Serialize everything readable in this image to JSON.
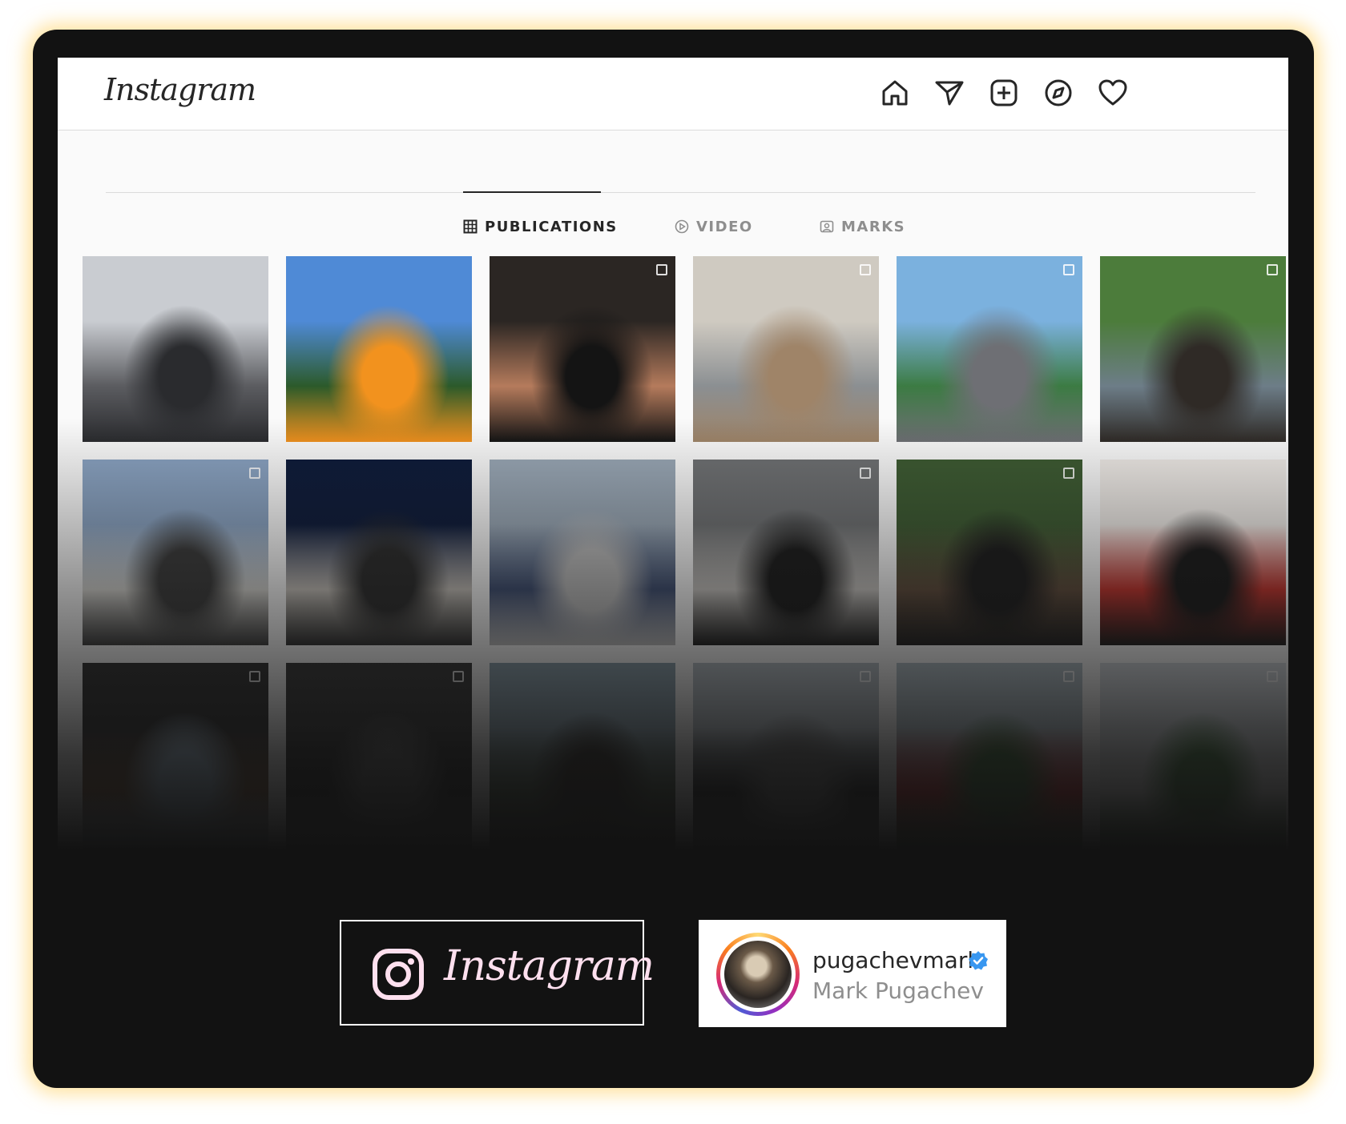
{
  "app": {
    "logo_text": "Instagram"
  },
  "nav": {
    "icons": [
      "home-icon",
      "direct-message-icon",
      "new-post-icon",
      "explore-icon",
      "activity-heart-icon"
    ]
  },
  "tabs": [
    {
      "label": "PUBLICATIONS",
      "icon": "grid-icon",
      "active": true
    },
    {
      "label": "VIDEO",
      "icon": "play-icon",
      "active": false
    },
    {
      "label": "MARKS",
      "icon": "tagged-icon",
      "active": false
    }
  ],
  "grid": {
    "rows": 3,
    "columns": 6,
    "tiles": [
      {
        "colors": [
          "#c9ccd1",
          "#5b5c60",
          "#2a2b2e"
        ],
        "multi": false
      },
      {
        "colors": [
          "#4f8ad6",
          "#2c5a2a",
          "#f2921e"
        ],
        "multi": false
      },
      {
        "colors": [
          "#2b2623",
          "#b57b5c",
          "#141414"
        ],
        "multi": true
      },
      {
        "colors": [
          "#cfcac1",
          "#8b8f92",
          "#9f8468"
        ],
        "multi": true
      },
      {
        "colors": [
          "#7bb1de",
          "#3c7b43",
          "#6e6f74"
        ],
        "multi": true
      },
      {
        "colors": [
          "#4c7c3b",
          "#6d7d88",
          "#2f2a26"
        ],
        "multi": true
      },
      {
        "colors": [
          "#8aa3c2",
          "#d7d6d1",
          "#3b3b3b"
        ],
        "multi": true
      },
      {
        "colors": [
          "#0e1b3a",
          "#c9c4bd",
          "#2c2c2c"
        ],
        "multi": false
      },
      {
        "colors": [
          "#9aa8b6",
          "#3e4e72",
          "#bcbcbc"
        ],
        "multi": false
      },
      {
        "colors": [
          "#6f7173",
          "#c9c6c2",
          "#1b1b1b"
        ],
        "multi": true
      },
      {
        "colors": [
          "#3d5b32",
          "#5f4b3b",
          "#1c1c1c"
        ],
        "multi": true
      },
      {
        "colors": [
          "#efebe7",
          "#c8332c",
          "#1a1a1a"
        ],
        "multi": false
      },
      {
        "colors": [
          "#2d2d2d",
          "#7a5a40",
          "#a8c2d8"
        ],
        "multi": true
      },
      {
        "colors": [
          "#343434",
          "#1e1e1e",
          "#5c5c5c"
        ],
        "multi": true
      },
      {
        "colors": [
          "#8aa0ad",
          "#4a5a45",
          "#2e2a26"
        ],
        "multi": false
      },
      {
        "colors": [
          "#b7c0c7",
          "#1d1d1d",
          "#6f6f6f"
        ],
        "multi": true
      },
      {
        "colors": [
          "#b2c0c8",
          "#c7292f",
          "#3d6b38"
        ],
        "multi": true
      },
      {
        "colors": [
          "#d6dbe0",
          "#f4f4f2",
          "#4b7c46"
        ],
        "multi": true
      }
    ]
  },
  "brand_badge": {
    "icon": "instagram-icon",
    "text": "Instagram"
  },
  "profile_card": {
    "username": "pugachevmark",
    "full_name": "Mark Pugachev",
    "verified_icon": "verified-badge-icon"
  },
  "colors": {
    "frame": "#121212",
    "glow": "#ffce5a",
    "text_primary": "#262626",
    "text_secondary": "#8e8e8e",
    "verified": "#3897f0",
    "brand_text": "#ffe0ef"
  }
}
